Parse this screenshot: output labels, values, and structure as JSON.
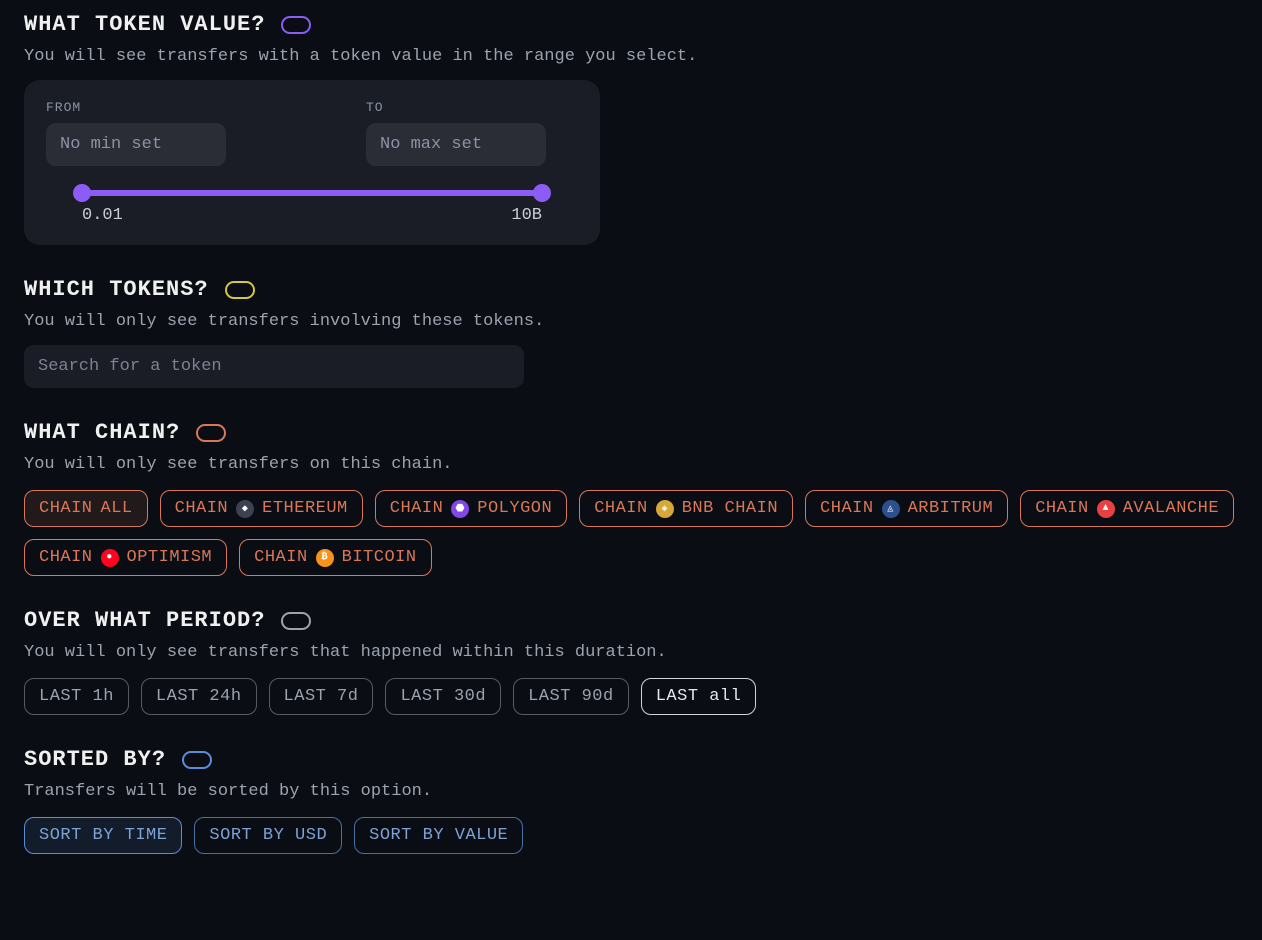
{
  "tokenValue": {
    "title": "WHAT TOKEN VALUE?",
    "desc": "You will see transfers with a token value in the range you select.",
    "fromLabel": "FROM",
    "toLabel": "TO",
    "fromPlaceholder": "No min set",
    "toPlaceholder": "No max set",
    "sliderMin": "0.01",
    "sliderMax": "10B"
  },
  "tokens": {
    "title": "WHICH TOKENS?",
    "desc": "You will only see transfers involving these tokens.",
    "searchPlaceholder": "Search for a token"
  },
  "chain": {
    "title": "WHAT CHAIN?",
    "desc": "You will only see transfers on this chain.",
    "prefix": "CHAIN",
    "options": [
      {
        "short": "ALL",
        "label": "ALL",
        "icon": null,
        "active": true
      },
      {
        "short": "ETHEREUM",
        "label": "ETHEREUM",
        "icon": "eth",
        "active": false
      },
      {
        "short": "POLYGON",
        "label": "POLYGON",
        "icon": "polygon",
        "active": false
      },
      {
        "short": "BNB CHAIN",
        "label": "BNB CHAIN",
        "icon": "bnb",
        "active": false
      },
      {
        "short": "ARBITRUM",
        "label": "ARBITRUM",
        "icon": "arb",
        "active": false
      },
      {
        "short": "AVALANCHE",
        "label": "AVALANCHE",
        "icon": "avax",
        "active": false
      },
      {
        "short": "OPTIMISM",
        "label": "OPTIMISM",
        "icon": "opt",
        "active": false
      },
      {
        "short": "BITCOIN",
        "label": "BITCOIN",
        "icon": "btc",
        "active": false
      }
    ]
  },
  "period": {
    "title": "OVER WHAT PERIOD?",
    "desc": "You will only see transfers that happened within this duration.",
    "prefix": "LAST",
    "options": [
      {
        "label": "1h",
        "active": false
      },
      {
        "label": "24h",
        "active": false
      },
      {
        "label": "7d",
        "active": false
      },
      {
        "label": "30d",
        "active": false
      },
      {
        "label": "90d",
        "active": false
      },
      {
        "label": "all",
        "active": true
      }
    ]
  },
  "sort": {
    "title": "SORTED BY?",
    "desc": "Transfers will be sorted by this option.",
    "prefix": "SORT BY",
    "options": [
      {
        "label": "TIME",
        "active": true
      },
      {
        "label": "USD",
        "active": false
      },
      {
        "label": "VALUE",
        "active": false
      }
    ]
  },
  "iconGlyph": {
    "eth": "◆",
    "polygon": "⬣",
    "bnb": "◈",
    "arb": "◬",
    "avax": "▲",
    "opt": "●",
    "btc": "₿"
  }
}
